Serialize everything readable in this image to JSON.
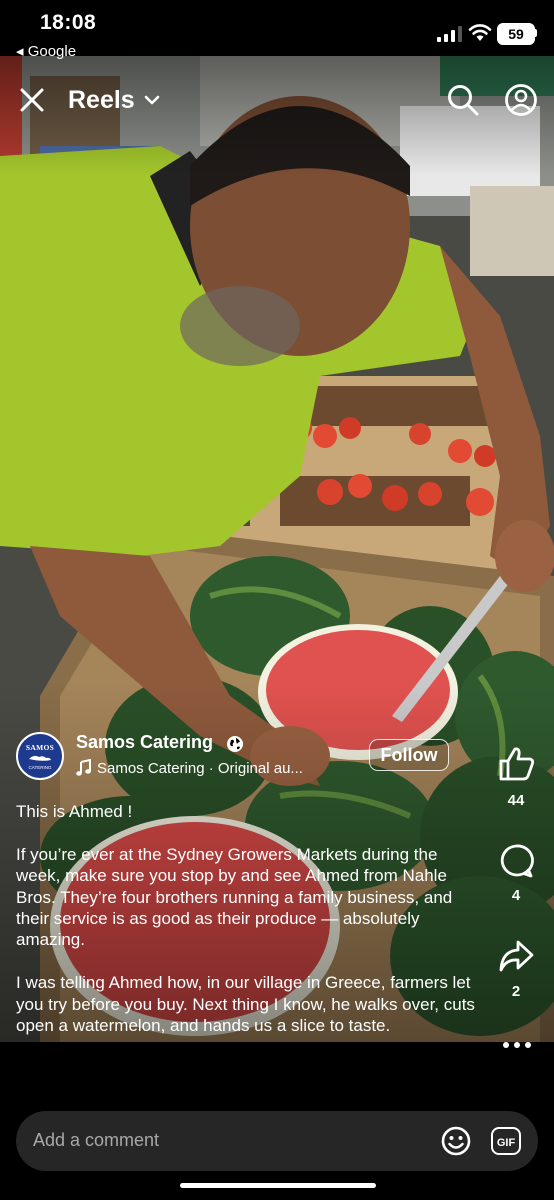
{
  "status_bar": {
    "time": "18:08",
    "back_app": "◂ Google",
    "battery": "59"
  },
  "header": {
    "title": "Reels",
    "close_icon": "close-icon",
    "search_icon": "search-icon",
    "profile_icon": "profile-icon"
  },
  "author": {
    "name": "Samos Catering",
    "avatar_text": "SAMOS",
    "avatar_sub": "CATERING",
    "audio": "Samos Catering · Original au...",
    "follow_label": "Follow"
  },
  "caption": {
    "p1": "This is Ahmed !",
    "p2": "If you’re ever at the Sydney Growers Markets during the week, make sure you stop by and see Ahmed from Nahle Bros. They’re four brothers running a family business, and their service is as good as their produce — absolutely amazing.",
    "p3": "I was telling Ahmed how, in our village in Greece, farmers let you try before you buy. Next thing I know, he walks over, cuts open a watermelon, and hands us a slice to taste."
  },
  "actions": {
    "likes": "44",
    "comments": "4",
    "shares": "2"
  },
  "comment_bar": {
    "placeholder": "Add a comment",
    "gif_label": "GIF"
  },
  "colors": {
    "accent_shirt": "#a3c62c",
    "melon_flesh": "#e0524f",
    "comment_bar_bg": "#262626"
  }
}
